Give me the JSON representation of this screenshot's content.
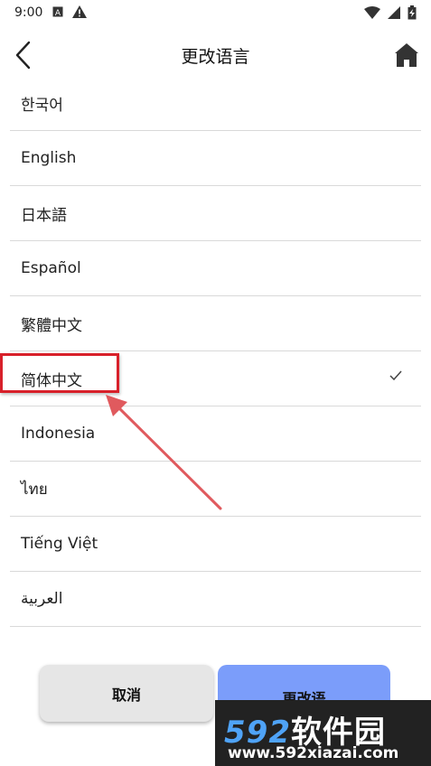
{
  "status_bar": {
    "time": "9:00",
    "left_icons": [
      "sim-a-icon",
      "warning-icon"
    ],
    "right_icons": [
      "wifi-icon",
      "signal-icon",
      "battery-charging-icon"
    ]
  },
  "app_bar": {
    "title": "更改语言",
    "back_icon": "chevron-left-icon",
    "home_icon": "home-icon"
  },
  "languages": [
    {
      "label": "한국어",
      "selected": false
    },
    {
      "label": "English",
      "selected": false
    },
    {
      "label": "日本語",
      "selected": false
    },
    {
      "label": "Español",
      "selected": false
    },
    {
      "label": "繁體中文",
      "selected": false
    },
    {
      "label": "简体中文",
      "selected": true
    },
    {
      "label": "Indonesia",
      "selected": false
    },
    {
      "label": "ไทย",
      "selected": false
    },
    {
      "label": "Tiếng Việt",
      "selected": false
    },
    {
      "label": "العربية",
      "selected": false
    }
  ],
  "footer": {
    "cancel_label": "取消",
    "confirm_label": "更改语"
  },
  "annotation": {
    "highlight_color": "#d8202a",
    "arrow_color": "#e05a5e"
  },
  "watermark": {
    "number": "592",
    "brand": "软件园",
    "url": "www.592xiazai.com"
  },
  "colors": {
    "confirm_bg": "#7b9dfa",
    "cancel_bg": "#e6e6e6",
    "divider": "#d9d9d9"
  }
}
